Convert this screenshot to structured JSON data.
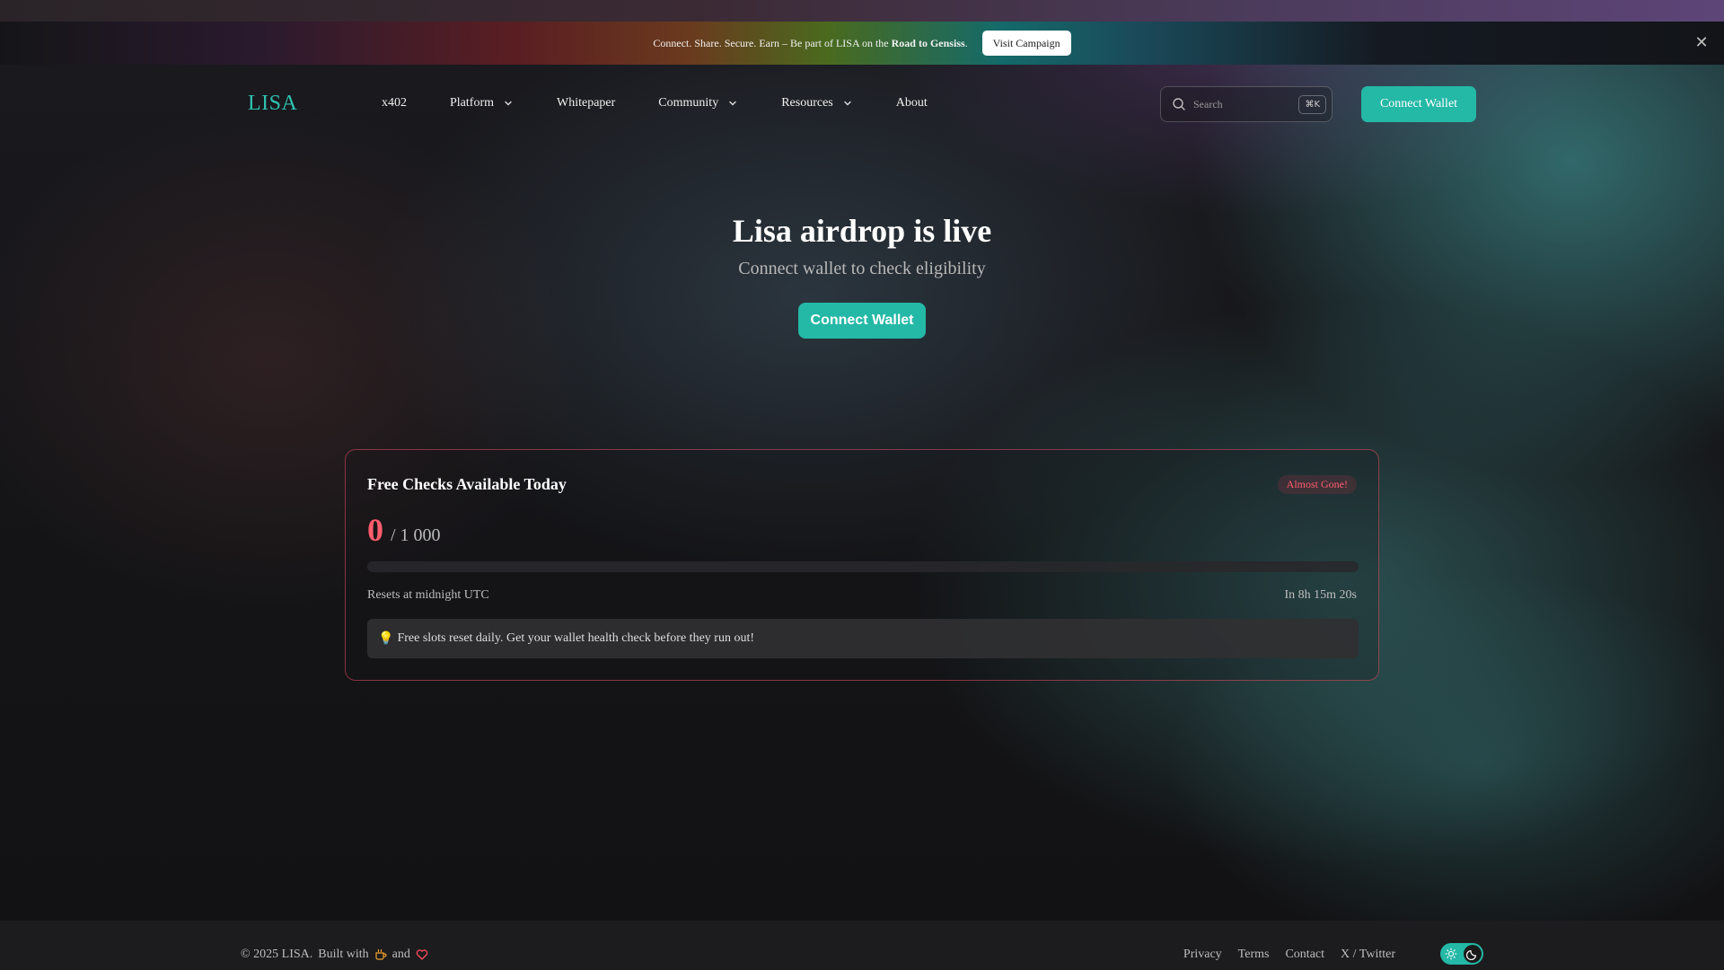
{
  "banner": {
    "text_prefix": "Connect. Share. Secure. Earn – Be part of LISA on the ",
    "text_bold": "Road to Gensiss",
    "text_suffix": ".",
    "button_label": "Visit  Campaign",
    "close_icon": "close-icon"
  },
  "nav": {
    "logo": "LISA",
    "items": [
      {
        "label": "x402",
        "has_dropdown": false
      },
      {
        "label": "Platform",
        "has_dropdown": true
      },
      {
        "label": "Whitepaper",
        "has_dropdown": false
      },
      {
        "label": "Community",
        "has_dropdown": true
      },
      {
        "label": "Resources",
        "has_dropdown": true
      },
      {
        "label": "About",
        "has_dropdown": false
      }
    ],
    "search": {
      "placeholder": "Search",
      "shortcut": "⌘K",
      "icon": "search-icon"
    },
    "cta_label": "Connect Wallet"
  },
  "hero": {
    "title": "Lisa airdrop is live",
    "subtitle": "Connect wallet to check eligibility",
    "cta_label": "Connect Wallet"
  },
  "card": {
    "title": "Free Checks Available Today",
    "badge": "Almost Gone!",
    "count_value": "0",
    "count_total": "/ 1 000",
    "progress_fraction": 0,
    "reset_label": "Resets at midnight UTC",
    "reset_timer": "In 8h 15m 20s",
    "tip_icon": "lightbulb-icon",
    "tip_text": "Free slots reset daily. Get your wallet health check before they run out!"
  },
  "footer": {
    "copyright": "© 2025 LISA.",
    "built_with": "Built with",
    "and": "and",
    "coffee_icon": "coffee-icon",
    "heart_icon": "heart-icon",
    "links": [
      "Privacy",
      "Terms",
      "Contact",
      "X / Twitter"
    ],
    "theme_toggle": {
      "active": "dark"
    }
  },
  "colors": {
    "accent": "#24b8a6",
    "logo": "#2fc2b0",
    "alert": "#ff5d6d",
    "card_border": "#e65064"
  }
}
